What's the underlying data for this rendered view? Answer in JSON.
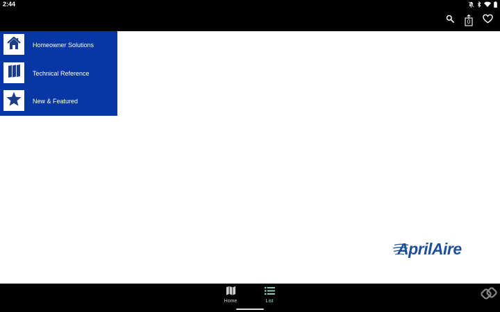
{
  "status_bar": {
    "time": "2:44",
    "icons": [
      "notifications-off-icon",
      "bluetooth-icon",
      "wifi-icon",
      "battery-icon"
    ]
  },
  "toolbar": {
    "actions": [
      "search-icon",
      "share-count-icon",
      "favorite-icon"
    ],
    "share_count": "0"
  },
  "menu": {
    "background_color": "#0737a5",
    "items": [
      {
        "label": "Homeowner Solutions",
        "icon": "house-icon"
      },
      {
        "label": "Technical Reference",
        "icon": "binders-icon"
      },
      {
        "label": "New & Featured",
        "icon": "star-icon"
      }
    ]
  },
  "brand": {
    "name": "AprilAire",
    "color": "#1d4f9a"
  },
  "bottom_nav": {
    "items": [
      {
        "label": "Home",
        "icon": "map-icon",
        "color": "#d0d0d0"
      },
      {
        "label": "List",
        "icon": "list-icon",
        "color": "#8fe0c8",
        "selected": true
      }
    ]
  }
}
